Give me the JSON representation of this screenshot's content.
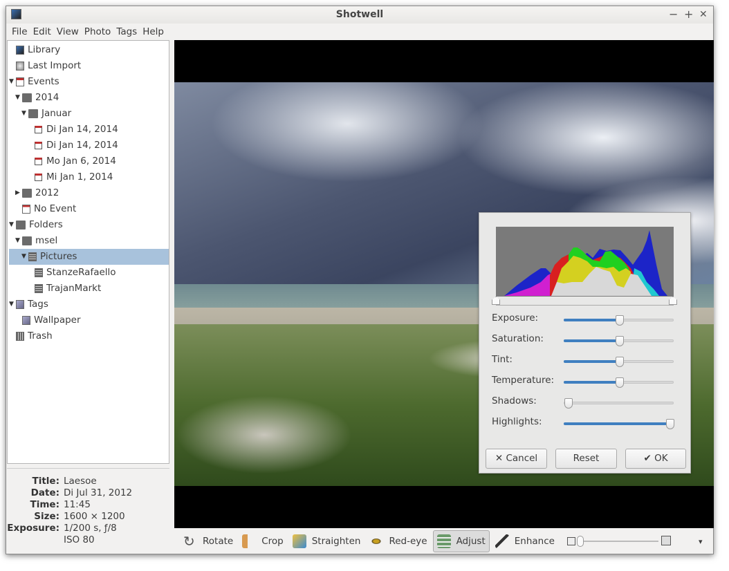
{
  "window": {
    "title": "Shotwell",
    "controls": [
      "−",
      "+",
      "✕"
    ]
  },
  "menu": [
    "File",
    "Edit",
    "View",
    "Photo",
    "Tags",
    "Help"
  ],
  "sidebar": {
    "items": [
      {
        "label": "Library",
        "icon": "library-icon",
        "depth": 0,
        "expander": ""
      },
      {
        "label": "Last Import",
        "icon": "clock-icon",
        "depth": 0,
        "expander": ""
      },
      {
        "label": "Events",
        "icon": "events-icon",
        "depth": 0,
        "expander": "▼"
      },
      {
        "label": "2014",
        "icon": "folder-icon",
        "depth": 1,
        "expander": "▼"
      },
      {
        "label": "Januar",
        "icon": "folder-icon",
        "depth": 2,
        "expander": "▼"
      },
      {
        "label": "Di Jan 14, 2014",
        "icon": "calendar-icon",
        "depth": 3,
        "expander": ""
      },
      {
        "label": "Di Jan 14, 2014",
        "icon": "calendar-icon",
        "depth": 3,
        "expander": ""
      },
      {
        "label": "Mo Jan 6, 2014",
        "icon": "calendar-icon",
        "depth": 3,
        "expander": ""
      },
      {
        "label": "Mi Jan 1, 2014",
        "icon": "calendar-icon",
        "depth": 3,
        "expander": ""
      },
      {
        "label": "2012",
        "icon": "folder-icon",
        "depth": 1,
        "expander": "▶"
      },
      {
        "label": "No Event",
        "icon": "no-event-icon",
        "depth": 1,
        "expander": ""
      },
      {
        "label": "Folders",
        "icon": "folder-icon",
        "depth": 0,
        "expander": "▼"
      },
      {
        "label": "msel",
        "icon": "folder-icon",
        "depth": 1,
        "expander": "▼"
      },
      {
        "label": "Pictures",
        "icon": "document-icon",
        "depth": 2,
        "expander": "▼",
        "selected": true
      },
      {
        "label": "StanzeRafaello",
        "icon": "document-icon",
        "depth": 3,
        "expander": ""
      },
      {
        "label": "TrajanMarkt",
        "icon": "document-icon",
        "depth": 3,
        "expander": ""
      },
      {
        "label": "Tags",
        "icon": "tag-icon",
        "depth": 0,
        "expander": "▼"
      },
      {
        "label": "Wallpaper",
        "icon": "tag-icon",
        "depth": 1,
        "expander": ""
      },
      {
        "label": "Trash",
        "icon": "trash-icon",
        "depth": 0,
        "expander": ""
      }
    ]
  },
  "info": [
    {
      "key": "Title:",
      "value": "Laesoe"
    },
    {
      "key": "Date:",
      "value": "Di Jul 31, 2012"
    },
    {
      "key": "Time:",
      "value": "11:45"
    },
    {
      "key": "Size:",
      "value": "1600 × 1200"
    },
    {
      "key": "Exposure:",
      "value": "1/200 s, ƒ/8"
    },
    {
      "key": "",
      "value": "ISO 80"
    }
  ],
  "adjust": {
    "sliders": [
      {
        "label": "Exposure:",
        "value": 0.5
      },
      {
        "label": "Saturation:",
        "value": 0.5
      },
      {
        "label": "Tint:",
        "value": 0.5
      },
      {
        "label": "Temperature:",
        "value": 0.5
      },
      {
        "label": "Shadows:",
        "value": 0.0
      },
      {
        "label": "Highlights:",
        "value": 1.0
      }
    ],
    "cancel": "Cancel",
    "reset": "Reset",
    "ok": "OK",
    "cancel_icon": "✕",
    "ok_icon": "✔"
  },
  "toolbar": {
    "items": [
      {
        "label": "Rotate",
        "icon": "rotate-icon"
      },
      {
        "label": "Crop",
        "icon": "crop-icon"
      },
      {
        "label": "Straighten",
        "icon": "straighten-icon"
      },
      {
        "label": "Red-eye",
        "icon": "red-eye-icon"
      },
      {
        "label": "Adjust",
        "icon": "adjust-icon",
        "active": true
      },
      {
        "label": "Enhance",
        "icon": "enhance-icon"
      }
    ],
    "zoom": 0.0,
    "more": "▾"
  },
  "colors": {
    "selection": "#a8c2dc",
    "accent": "#3f7fc0"
  }
}
